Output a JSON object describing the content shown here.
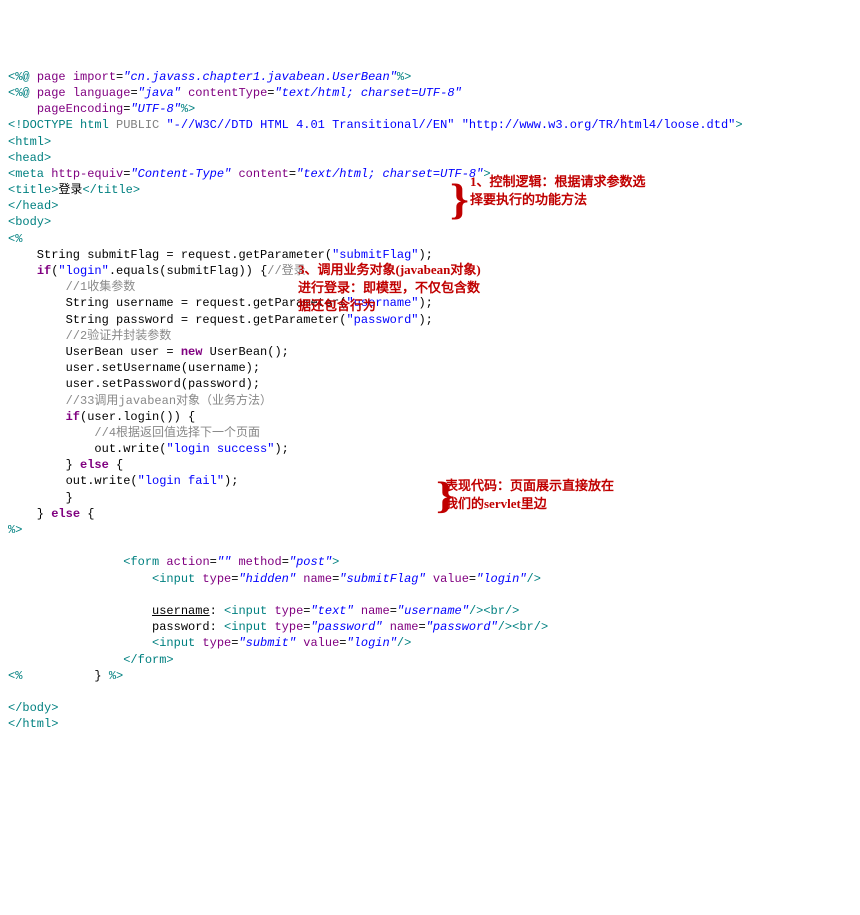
{
  "lines": {
    "l1_a": "<%@",
    "l1_b": "page",
    "l1_c": "import",
    "l1_d": "=",
    "l1_e": "\"cn.javass.chapter1.javabean.UserBean\"",
    "l1_f": "%>",
    "l2_a": "<%@",
    "l2_b": "page",
    "l2_c": "language",
    "l2_d": "=",
    "l2_e": "\"java\"",
    "l2_f": "contentType",
    "l2_g": "=",
    "l2_h": "\"text/html; charset=UTF-8\"",
    "l3_a": "pageEncoding",
    "l3_b": "=",
    "l3_c": "\"UTF-8\"",
    "l3_d": "%>",
    "l4_a": "<!DOCTYPE",
    "l4_b": "html",
    "l4_c": "PUBLIC",
    "l4_d": "\"-//W3C//DTD HTML 4.01 Transitional//EN\"",
    "l4_e": "\"http://www.w3.org/TR/html4/loose.dtd\"",
    "l4_f": ">",
    "l5": "<html>",
    "l6": "<head>",
    "l7_a": "<meta",
    "l7_b": "http-equiv",
    "l7_c": "=",
    "l7_d": "\"Content-Type\"",
    "l7_e": "content",
    "l7_f": "=",
    "l7_g": "\"text/html; charset=UTF-8\"",
    "l7_h": ">",
    "l8_a": "<title>",
    "l8_b": "登录",
    "l8_c": "</title>",
    "l9": "</head>",
    "l10": "<body>",
    "l11_a": "<%",
    "l12": "    String submitFlag = request.getParameter(\"submitFlag\");",
    "l12_call": "    String submitFlag = request.getParameter(",
    "l12_str": "\"submitFlag\"",
    "l12_end": ");",
    "l13_a": "    ",
    "l13_b": "if",
    "l13_c": "(",
    "l13_d": "\"login\"",
    "l13_e": ".equals(submitFlag)) {",
    "l13_f": "//登录",
    "l14": "        //1收集参数",
    "l15_a": "        String username = request.getParameter(",
    "l15_b": "\"username\"",
    "l15_c": ");",
    "l16_a": "        String password = request.getParameter(",
    "l16_b": "\"password\"",
    "l16_c": ");",
    "l17": "        //2验证并封装参数",
    "l18_a": "        UserBean user = ",
    "l18_b": "new",
    "l18_c": " UserBean();",
    "l19": "        user.setUsername(username);",
    "l20": "        user.setPassword(password);",
    "l21": "        //33调用javabean对象（业务方法）",
    "l22_a": "        ",
    "l22_b": "if",
    "l22_c": "(user.login()) {",
    "l23": "            //4根据返回值选择下一个页面",
    "l24_a": "            out.write(",
    "l24_b": "\"login success\"",
    "l24_c": ");",
    "l25_a": "        } ",
    "l25_b": "else",
    "l25_c": " {",
    "l26_a": "        out.write(",
    "l26_b": "\"login fail\"",
    "l26_c": ");",
    "l27": "        }",
    "l28_a": "    } ",
    "l28_b": "else",
    "l28_c": " {",
    "l29": "%>",
    "blank1": "",
    "l30_a": "                <form",
    "l30_b": " action",
    "l30_c": "=",
    "l30_d": "\"\"",
    "l30_e": " method",
    "l30_f": "=",
    "l30_g": "\"post\"",
    "l30_h": ">",
    "l31_a": "                    <input",
    "l31_b": " type",
    "l31_c": "=",
    "l31_d": "\"hidden\"",
    "l31_e": " name",
    "l31_f": "=",
    "l31_g": "\"submitFlag\"",
    "l31_h": " value",
    "l31_i": "=",
    "l31_j": "\"login\"",
    "l31_k": "/>",
    "blank2": "",
    "l32_a": "                    ",
    "l32_b": "username",
    "l32_c": ":",
    "l32_d": " <input",
    "l32_e": " type",
    "l32_f": "=",
    "l32_g": "\"text\"",
    "l32_h": " name",
    "l32_i": "=",
    "l32_j": "\"username\"",
    "l32_k": "/>",
    "l32_l": "<br/>",
    "l33_a": "                    password:",
    "l33_b": " <input",
    "l33_c": " type",
    "l33_d": "=",
    "l33_e": "\"password\"",
    "l33_f": " name",
    "l33_g": "=",
    "l33_h": "\"password\"",
    "l33_i": "/>",
    "l33_j": "<br/>",
    "l34_a": "                    <input",
    "l34_b": " type",
    "l34_c": "=",
    "l34_d": "\"submit\"",
    "l34_e": " value",
    "l34_f": "=",
    "l34_g": "\"login\"",
    "l34_h": "/>",
    "l35": "                </form>",
    "l36_a": "<%",
    "l36_b": "          }",
    "l36_c": " %>",
    "blank3": "",
    "l37": "</body>",
    "l38": "</html>"
  },
  "annotations": {
    "a1": "1、控制逻辑：根据请求参数选择要执行的功能方法",
    "a2": "3、调用业务对象(javabean对象)进行登录：即模型，不仅包含数据还包含行为",
    "a3": "表现代码：页面展示直接放在我们的servlet里边",
    "brace": "}"
  }
}
